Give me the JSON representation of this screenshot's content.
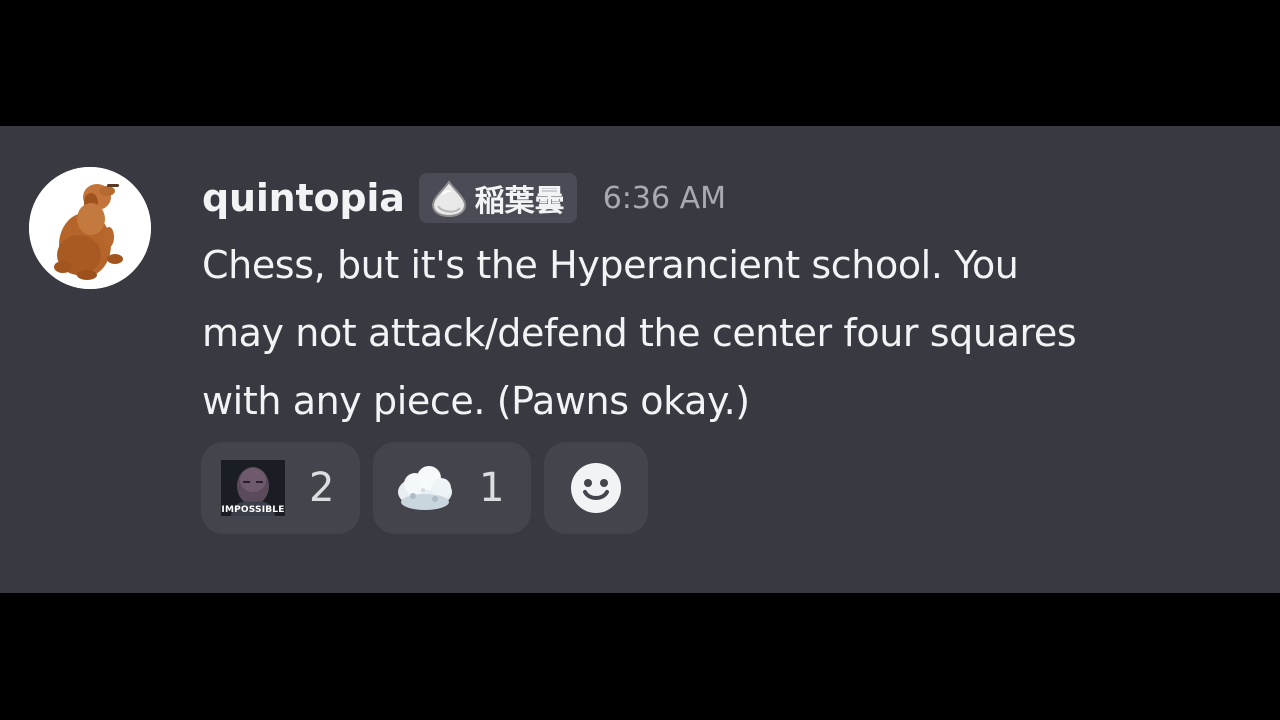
{
  "message": {
    "author": "quintopia",
    "clan_tag": {
      "icon": "silver-drop-icon",
      "text": "稲葉曇"
    },
    "timestamp": "6:36 AM",
    "content_lines": [
      "Chess, but it's the Hyperancient school. You",
      "may not attack/defend the center four squares",
      "with any piece. (Pawns okay.)"
    ],
    "avatar": {
      "icon": "golden-retriever-avatar"
    }
  },
  "reactions": [
    {
      "emoji": "impossible-thanos-emoji",
      "emoji_text": "IMPOSSIBLE",
      "count": "2"
    },
    {
      "emoji": "snow-cloud-emoji",
      "count": "1"
    }
  ],
  "add_reaction": {
    "icon": "smiley-face-icon"
  },
  "colors": {
    "background": "#393941",
    "letterbox": "#000000",
    "text": "#f2f3f5",
    "timestamp": "#a8a9b1",
    "reaction_bg": "#43444c",
    "tag_bg": "#4a4b54"
  }
}
